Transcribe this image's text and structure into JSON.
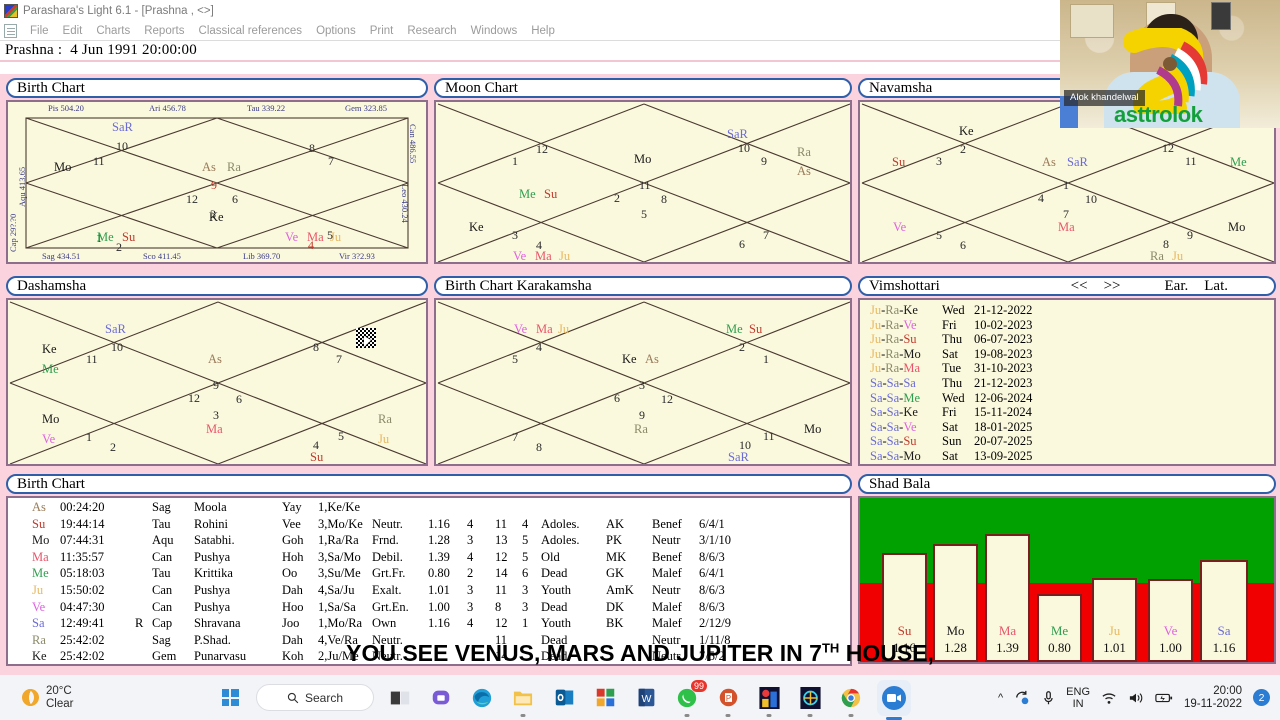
{
  "window": {
    "title": "Parashara's Light 6.1 - [Prashna ,  <>]",
    "app_icon": "app-icon"
  },
  "menu": {
    "items": [
      "File",
      "Edit",
      "Charts",
      "Reports",
      "Classical references",
      "Options",
      "Print",
      "Research",
      "Windows",
      "Help"
    ]
  },
  "prashna": {
    "label": "Prashna :",
    "value": "4 Jun 1991  20:00:00"
  },
  "panels": {
    "birth_chart": {
      "title": "Birth Chart",
      "rim_top": [
        "Pis  504.20",
        "Ari  456.78",
        "Tau  339.22",
        "Gem  323.85"
      ],
      "rim_bottom": [
        "Sag  434.51",
        "Sco  411.45",
        "Lib  369.70",
        "Vir  3?2.93"
      ],
      "rim_left": [
        "Aqu  413.65",
        "Cap  29?.?0"
      ],
      "rim_right": [
        "Can  486.55",
        "Leo  430.24"
      ],
      "houses": [
        "1",
        "2",
        "3",
        "4",
        "5",
        "6",
        "7",
        "8",
        "9",
        "10",
        "11",
        "12"
      ],
      "placements": [
        {
          "house": 11,
          "text": "Mo",
          "color": "Mo"
        },
        {
          "house": 12,
          "text": "SaR",
          "color": "SaR"
        },
        {
          "house": 1,
          "text": "As",
          "color": "As"
        },
        {
          "house": 1,
          "text": "Ra",
          "color": "Ra"
        },
        {
          "house": 3,
          "text": "Ke",
          "color": "Ke"
        },
        {
          "house": 5,
          "text": "Ve",
          "color": "Ve"
        },
        {
          "house": 5,
          "text": "Ma",
          "color": "Ma"
        },
        {
          "house": 5,
          "text": "Ju",
          "color": "Ju"
        },
        {
          "house": 6,
          "text": "Me",
          "color": "Me"
        },
        {
          "house": 6,
          "text": "Su",
          "color": "Su"
        }
      ]
    },
    "moon_chart": {
      "title": "Moon Chart",
      "placements": [
        {
          "text": "SaR",
          "color": "SaR"
        },
        {
          "text": "Ra",
          "color": "Ra"
        },
        {
          "text": "As",
          "color": "As"
        },
        {
          "text": "Mo",
          "color": "Mo"
        },
        {
          "text": "Me",
          "color": "Me"
        },
        {
          "text": "Su",
          "color": "Su"
        },
        {
          "text": "Ke",
          "color": "Ke"
        },
        {
          "text": "Ve",
          "color": "Ve"
        },
        {
          "text": "Ma",
          "color": "Ma"
        },
        {
          "text": "Ju",
          "color": "Ju"
        }
      ]
    },
    "navamsha": {
      "title": "Navamsha",
      "placements": [
        {
          "text": "Ke",
          "color": "Ke"
        },
        {
          "text": "Su",
          "color": "Su"
        },
        {
          "text": "As",
          "color": "As"
        },
        {
          "text": "SaR",
          "color": "SaR"
        },
        {
          "text": "Me",
          "color": "Me"
        },
        {
          "text": "Ve",
          "color": "Ve"
        },
        {
          "text": "Ma",
          "color": "Ma"
        },
        {
          "text": "Mo",
          "color": "Mo"
        },
        {
          "text": "Ra",
          "color": "Ra"
        },
        {
          "text": "Ju",
          "color": "Ju"
        }
      ]
    },
    "dashamsha": {
      "title": "Dashamsha",
      "placements": [
        {
          "text": "SaR",
          "color": "SaR"
        },
        {
          "text": "Ke",
          "color": "Ke"
        },
        {
          "text": "Me",
          "color": "Me"
        },
        {
          "text": "As",
          "color": "As"
        },
        {
          "text": "Mo",
          "color": "Mo"
        },
        {
          "text": "Ve",
          "color": "Ve"
        },
        {
          "text": "Ma",
          "color": "Ma"
        },
        {
          "text": "Ra",
          "color": "Ra"
        },
        {
          "text": "Ju",
          "color": "Ju"
        },
        {
          "text": "Su",
          "color": "Su"
        }
      ]
    },
    "karakamsha": {
      "title": "Birth Chart  Karakamsha",
      "placements": [
        {
          "text": "Ve",
          "color": "Ve"
        },
        {
          "text": "Ma",
          "color": "Ma"
        },
        {
          "text": "Ju",
          "color": "Ju"
        },
        {
          "text": "Me",
          "color": "Me"
        },
        {
          "text": "Su",
          "color": "Su"
        },
        {
          "text": "Ke",
          "color": "Ke"
        },
        {
          "text": "As",
          "color": "As"
        },
        {
          "text": "Ra",
          "color": "Ra"
        },
        {
          "text": "Mo",
          "color": "Mo"
        },
        {
          "text": "SaR",
          "color": "SaR"
        }
      ]
    },
    "vimshottari": {
      "title": "Vimshottari",
      "prev_label": "<<",
      "next_label": ">>",
      "ear_label": "Ear.",
      "lat_label": "Lat.",
      "rows": [
        {
          "dasha": "Ju-Ra-Ke",
          "c1": "Ju",
          "c2": "Ra",
          "c3": "Ke",
          "day": "Wed",
          "date": "21-12-2022"
        },
        {
          "dasha": "Ju-Ra-Ve",
          "c1": "Ju",
          "c2": "Ra",
          "c3": "Ve",
          "day": "Fri",
          "date": "10-02-2023"
        },
        {
          "dasha": "Ju-Ra-Su",
          "c1": "Ju",
          "c2": "Ra",
          "c3": "Su",
          "day": "Thu",
          "date": "06-07-2023"
        },
        {
          "dasha": "Ju-Ra-Mo",
          "c1": "Ju",
          "c2": "Ra",
          "c3": "Mo",
          "day": "Sat",
          "date": "19-08-2023"
        },
        {
          "dasha": "Ju-Ra-Ma",
          "c1": "Ju",
          "c2": "Ra",
          "c3": "Ma",
          "day": "Tue",
          "date": "31-10-2023"
        },
        {
          "dasha": "Sa-Sa-Sa",
          "c1": "Sa",
          "c2": "Sa",
          "c3": "Sa",
          "day": "Thu",
          "date": "21-12-2023"
        },
        {
          "dasha": "Sa-Sa-Me",
          "c1": "Sa",
          "c2": "Sa",
          "c3": "Me",
          "day": "Wed",
          "date": "12-06-2024"
        },
        {
          "dasha": "Sa-Sa-Ke",
          "c1": "Sa",
          "c2": "Sa",
          "c3": "Ke",
          "day": "Fri",
          "date": "15-11-2024"
        },
        {
          "dasha": "Sa-Sa-Ve",
          "c1": "Sa",
          "c2": "Sa",
          "c3": "Ve",
          "day": "Sat",
          "date": "18-01-2025"
        },
        {
          "dasha": "Sa-Sa-Su",
          "c1": "Sa",
          "c2": "Sa",
          "c3": "Su",
          "day": "Sun",
          "date": "20-07-2025"
        },
        {
          "dasha": "Sa-Sa-Mo",
          "c1": "Sa",
          "c2": "Sa",
          "c3": "Mo",
          "day": "Sat",
          "date": "13-09-2025"
        }
      ]
    },
    "planet_table": {
      "title": "Birth Chart",
      "rows": [
        {
          "pl": "As",
          "deg": "00:24:20",
          "r": "",
          "sign": "Sag",
          "nak": "Moola",
          "syl": "Yay",
          "pada": "1,Ke/Ke",
          "rel": "",
          "sb": "",
          "n1": "",
          "n2": "",
          "n3": "",
          "avastha": "",
          "karaka": "",
          "nature": "",
          "ratio": ""
        },
        {
          "pl": "Su",
          "deg": "19:44:14",
          "r": "",
          "sign": "Tau",
          "nak": "Rohini",
          "syl": "Vee",
          "pada": "3,Mo/Ke",
          "rel": "Neutr.",
          "sb": "1.16",
          "n1": "4",
          "n2": "11",
          "n3": "4",
          "avastha": "Adoles.",
          "karaka": "AK",
          "nature": "Benef",
          "ratio": "6/4/1"
        },
        {
          "pl": "Mo",
          "deg": "07:44:31",
          "r": "",
          "sign": "Aqu",
          "nak": "Satabhi.",
          "syl": "Goh",
          "pada": "1,Ra/Ra",
          "rel": "Frnd.",
          "sb": "1.28",
          "n1": "3",
          "n2": "13",
          "n3": "5",
          "avastha": "Adoles.",
          "karaka": "PK",
          "nature": "Neutr",
          "ratio": "3/1/10"
        },
        {
          "pl": "Ma",
          "deg": "11:35:57",
          "r": "",
          "sign": "Can",
          "nak": "Pushya",
          "syl": "Hoh",
          "pada": "3,Sa/Mo",
          "rel": "Debil.",
          "sb": "1.39",
          "n1": "4",
          "n2": "12",
          "n3": "5",
          "avastha": "Old",
          "karaka": "MK",
          "nature": "Benef",
          "ratio": "8/6/3"
        },
        {
          "pl": "Me",
          "deg": "05:18:03",
          "r": "",
          "sign": "Tau",
          "nak": "Krittika",
          "syl": "Oo",
          "pada": "3,Su/Me",
          "rel": "Grt.Fr.",
          "sb": "0.80",
          "n1": "2",
          "n2": "14",
          "n3": "6",
          "avastha": "Dead",
          "karaka": "GK",
          "nature": "Malef",
          "ratio": "6/4/1"
        },
        {
          "pl": "Ju",
          "deg": "15:50:02",
          "r": "",
          "sign": "Can",
          "nak": "Pushya",
          "syl": "Dah",
          "pada": "4,Sa/Ju",
          "rel": "Exalt.",
          "sb": "1.01",
          "n1": "3",
          "n2": "11",
          "n3": "3",
          "avastha": "Youth",
          "karaka": "AmK",
          "nature": "Neutr",
          "ratio": "8/6/3"
        },
        {
          "pl": "Ve",
          "deg": "04:47:30",
          "r": "",
          "sign": "Can",
          "nak": "Pushya",
          "syl": "Hoo",
          "pada": "1,Sa/Sa",
          "rel": "Grt.En.",
          "sb": "1.00",
          "n1": "3",
          "n2": "8",
          "n3": "3",
          "avastha": "Dead",
          "karaka": "DK",
          "nature": "Malef",
          "ratio": "8/6/3"
        },
        {
          "pl": "Sa",
          "deg": "12:49:41",
          "r": "R",
          "sign": "Cap",
          "nak": "Shravana",
          "syl": "Joo",
          "pada": "1,Mo/Ra",
          "rel": "Own",
          "sb": "1.16",
          "n1": "4",
          "n2": "12",
          "n3": "1",
          "avastha": "Youth",
          "karaka": "BK",
          "nature": "Malef",
          "ratio": "2/12/9"
        },
        {
          "pl": "Ra",
          "deg": "25:42:02",
          "r": "",
          "sign": "Sag",
          "nak": "P.Shad.",
          "syl": "Dah",
          "pada": "4,Ve/Ra",
          "rel": "Neutr.",
          "sb": "",
          "n1": "",
          "n2": "11",
          "n3": "",
          "avastha": "Dead",
          "karaka": "",
          "nature": "Neutr",
          "ratio": "1/11/8"
        },
        {
          "pl": "Ke",
          "deg": "25:42:02",
          "r": "",
          "sign": "Gem",
          "nak": "Punarvasu",
          "syl": "Koh",
          "pada": "2,Ju/Me",
          "rel": "Neutr.",
          "sb": "",
          "n1": "",
          "n2": "14",
          "n3": "",
          "avastha": "Dead",
          "karaka": "",
          "nature": "Neutr",
          "ratio": "7/5/2"
        }
      ]
    },
    "shad_bala": {
      "title": "Shad Bala",
      "chart_ref": "chart_data"
    }
  },
  "chart_data": {
    "type": "bar",
    "title": "Shad Bala",
    "categories": [
      "Su",
      "Mo",
      "Ma",
      "Me",
      "Ju",
      "Ve",
      "Sa"
    ],
    "values": [
      1.16,
      1.28,
      1.39,
      0.8,
      1.01,
      1.0,
      1.16
    ],
    "labels": [
      "1.16",
      "1.28",
      "1.39",
      "0.80",
      "1.01",
      "1.00",
      "1.16"
    ],
    "threshold": 1.0,
    "background_above_threshold": "#00a100",
    "background_below_threshold": "#f00000",
    "bar_fill": "#fbf9dd",
    "bar_border": "#7a1f1f",
    "xlabel": "",
    "ylabel": "",
    "grid": false,
    "legend": false
  },
  "subtitle": {
    "text": "YOU SEE  VENUS, MARS AND JUPITER IN 7",
    "sup": "TH",
    "tail": " HOUSE,"
  },
  "webcam": {
    "name": "Alok khandelwal",
    "brand": "asttrolok"
  },
  "taskbar": {
    "weather": {
      "temp": "20°C",
      "cond": "Clear"
    },
    "search_label": "Search",
    "apps": [
      "start",
      "taskview",
      "teams",
      "edge",
      "explorer",
      "outlook",
      "store",
      "word",
      "whatsapp",
      "powerpoint",
      "app1",
      "app2",
      "chrome",
      "zoom"
    ],
    "whatsapp_badge": "99",
    "language": {
      "l1": "ENG",
      "l2": "IN"
    },
    "clock": {
      "time": "20:00",
      "date": "19-11-2022"
    },
    "notifications": "2"
  }
}
